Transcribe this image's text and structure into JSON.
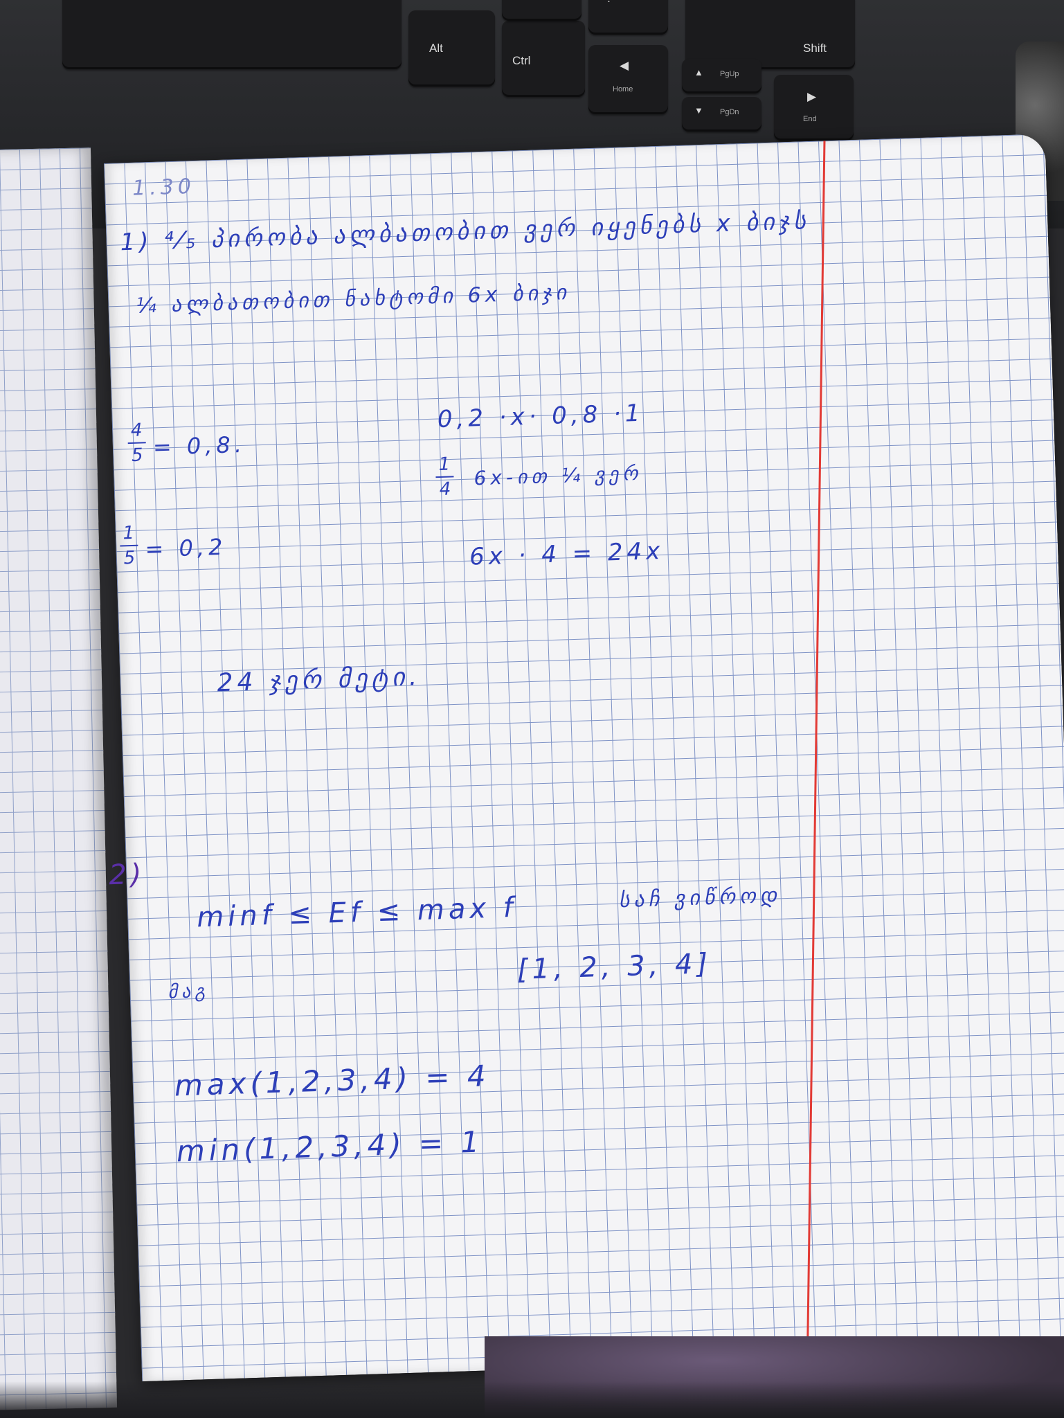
{
  "keyboard": {
    "keys": {
      "alt": "Alt",
      "ctrl": "Ctrl",
      "shift": "Shift",
      "home": "Home",
      "pgup": "PgUp",
      "pgdn": "PgDn",
      "end": "End",
      "question": "?"
    }
  },
  "notebook": {
    "lines": {
      "problem_number": "1.30",
      "line1": "1) ⁴⁄₅ პირობა ალბათობით ვერ იყენებს x ბიჯს",
      "line2": "¼ ალბათობით ნახტომი 6x ბიჯი",
      "frac_a_value": "= 0,8.",
      "frac_b_value": "= 0,2",
      "probs": "0,2 ·x· 0,8 ·1",
      "quarter_text": "6x-ით ¼ ვერ",
      "equation": "6x · 4 = 24x",
      "answer": "24 ჯერ მეტი.",
      "section2_mark": "2)",
      "inequality": "minf ≤ Ef ≤ max f",
      "inequality_note": "საჩ ვიწროდ",
      "example_label": "მაგ",
      "example_set": "[1, 2, 3, 4]",
      "max_line": "max(1,2,3,4) = 4",
      "min_line": "min(1,2,3,4) = 1"
    },
    "fractions": {
      "a": {
        "num": "4",
        "den": "5"
      },
      "b": {
        "num": "1",
        "den": "5"
      },
      "c": {
        "num": "1",
        "den": "4"
      }
    }
  }
}
